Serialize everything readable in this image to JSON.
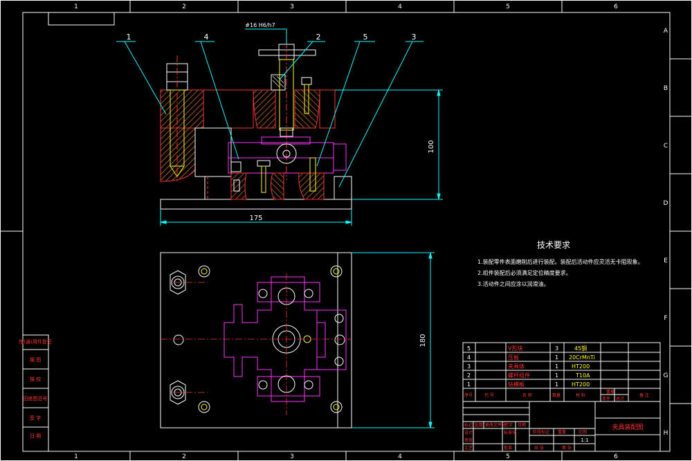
{
  "drawing": {
    "top_fit_label": "#16 H6/h7",
    "dimension_width": "175",
    "dimension_height_front": "100",
    "dimension_height_plan": "180",
    "balloons": [
      "1",
      "4",
      "2",
      "5",
      "3"
    ]
  },
  "border": {
    "columns": [
      "1",
      "2",
      "3",
      "4",
      "5",
      "6"
    ],
    "rows": [
      "A",
      "B",
      "C",
      "D",
      "E",
      "F",
      "G",
      "H"
    ]
  },
  "tech_requirements": {
    "title": "技术要求",
    "items": [
      "1.装配零件表面磨削后进行装配。装配后活动件应灵活无卡阻现象。",
      "2.组件装配后必须满足定位精度要求。",
      "3.活动件之间应涂以润滑油。"
    ]
  },
  "left_strip": {
    "labels": [
      "借(通)用件登记",
      "描 图",
      "描 校",
      "旧底图总号",
      "签 字",
      "日 期"
    ]
  },
  "bom": {
    "rows": [
      {
        "no": "5",
        "name": "V形块",
        "qty": "3",
        "material": "45钢"
      },
      {
        "no": "4",
        "name": "压板",
        "qty": "1",
        "material": "20CrMnTi"
      },
      {
        "no": "3",
        "name": "夹具体",
        "qty": "1",
        "material": "HT200"
      },
      {
        "no": "2",
        "name": "螺杆组件",
        "qty": "1",
        "material": "T10A"
      },
      {
        "no": "1",
        "name": "钻模板",
        "qty": "1",
        "material": "HT200"
      }
    ],
    "header": [
      "序号",
      "代 号",
      "名 称",
      "数量",
      "材 料",
      "单件",
      "总计",
      "备 注"
    ],
    "header_sub": "重量"
  },
  "title_block": {
    "drawing_name": "夹具装配图",
    "scale": "1:1",
    "labels": [
      "标记",
      "处数",
      "更改文件号",
      "签字",
      "日期",
      "设计",
      "标准化",
      "审核",
      "工艺",
      "批准",
      "阶段标记",
      "重量",
      "比例",
      "共 张",
      "第 张"
    ]
  },
  "colors": {
    "frame": "#ffffff",
    "dimension": "#00ffff",
    "part_red": "#ff3333",
    "hatch": "#ff8c1a",
    "magenta": "#ff33ff",
    "yellow": "#ffff00",
    "green": "#33ff33"
  }
}
